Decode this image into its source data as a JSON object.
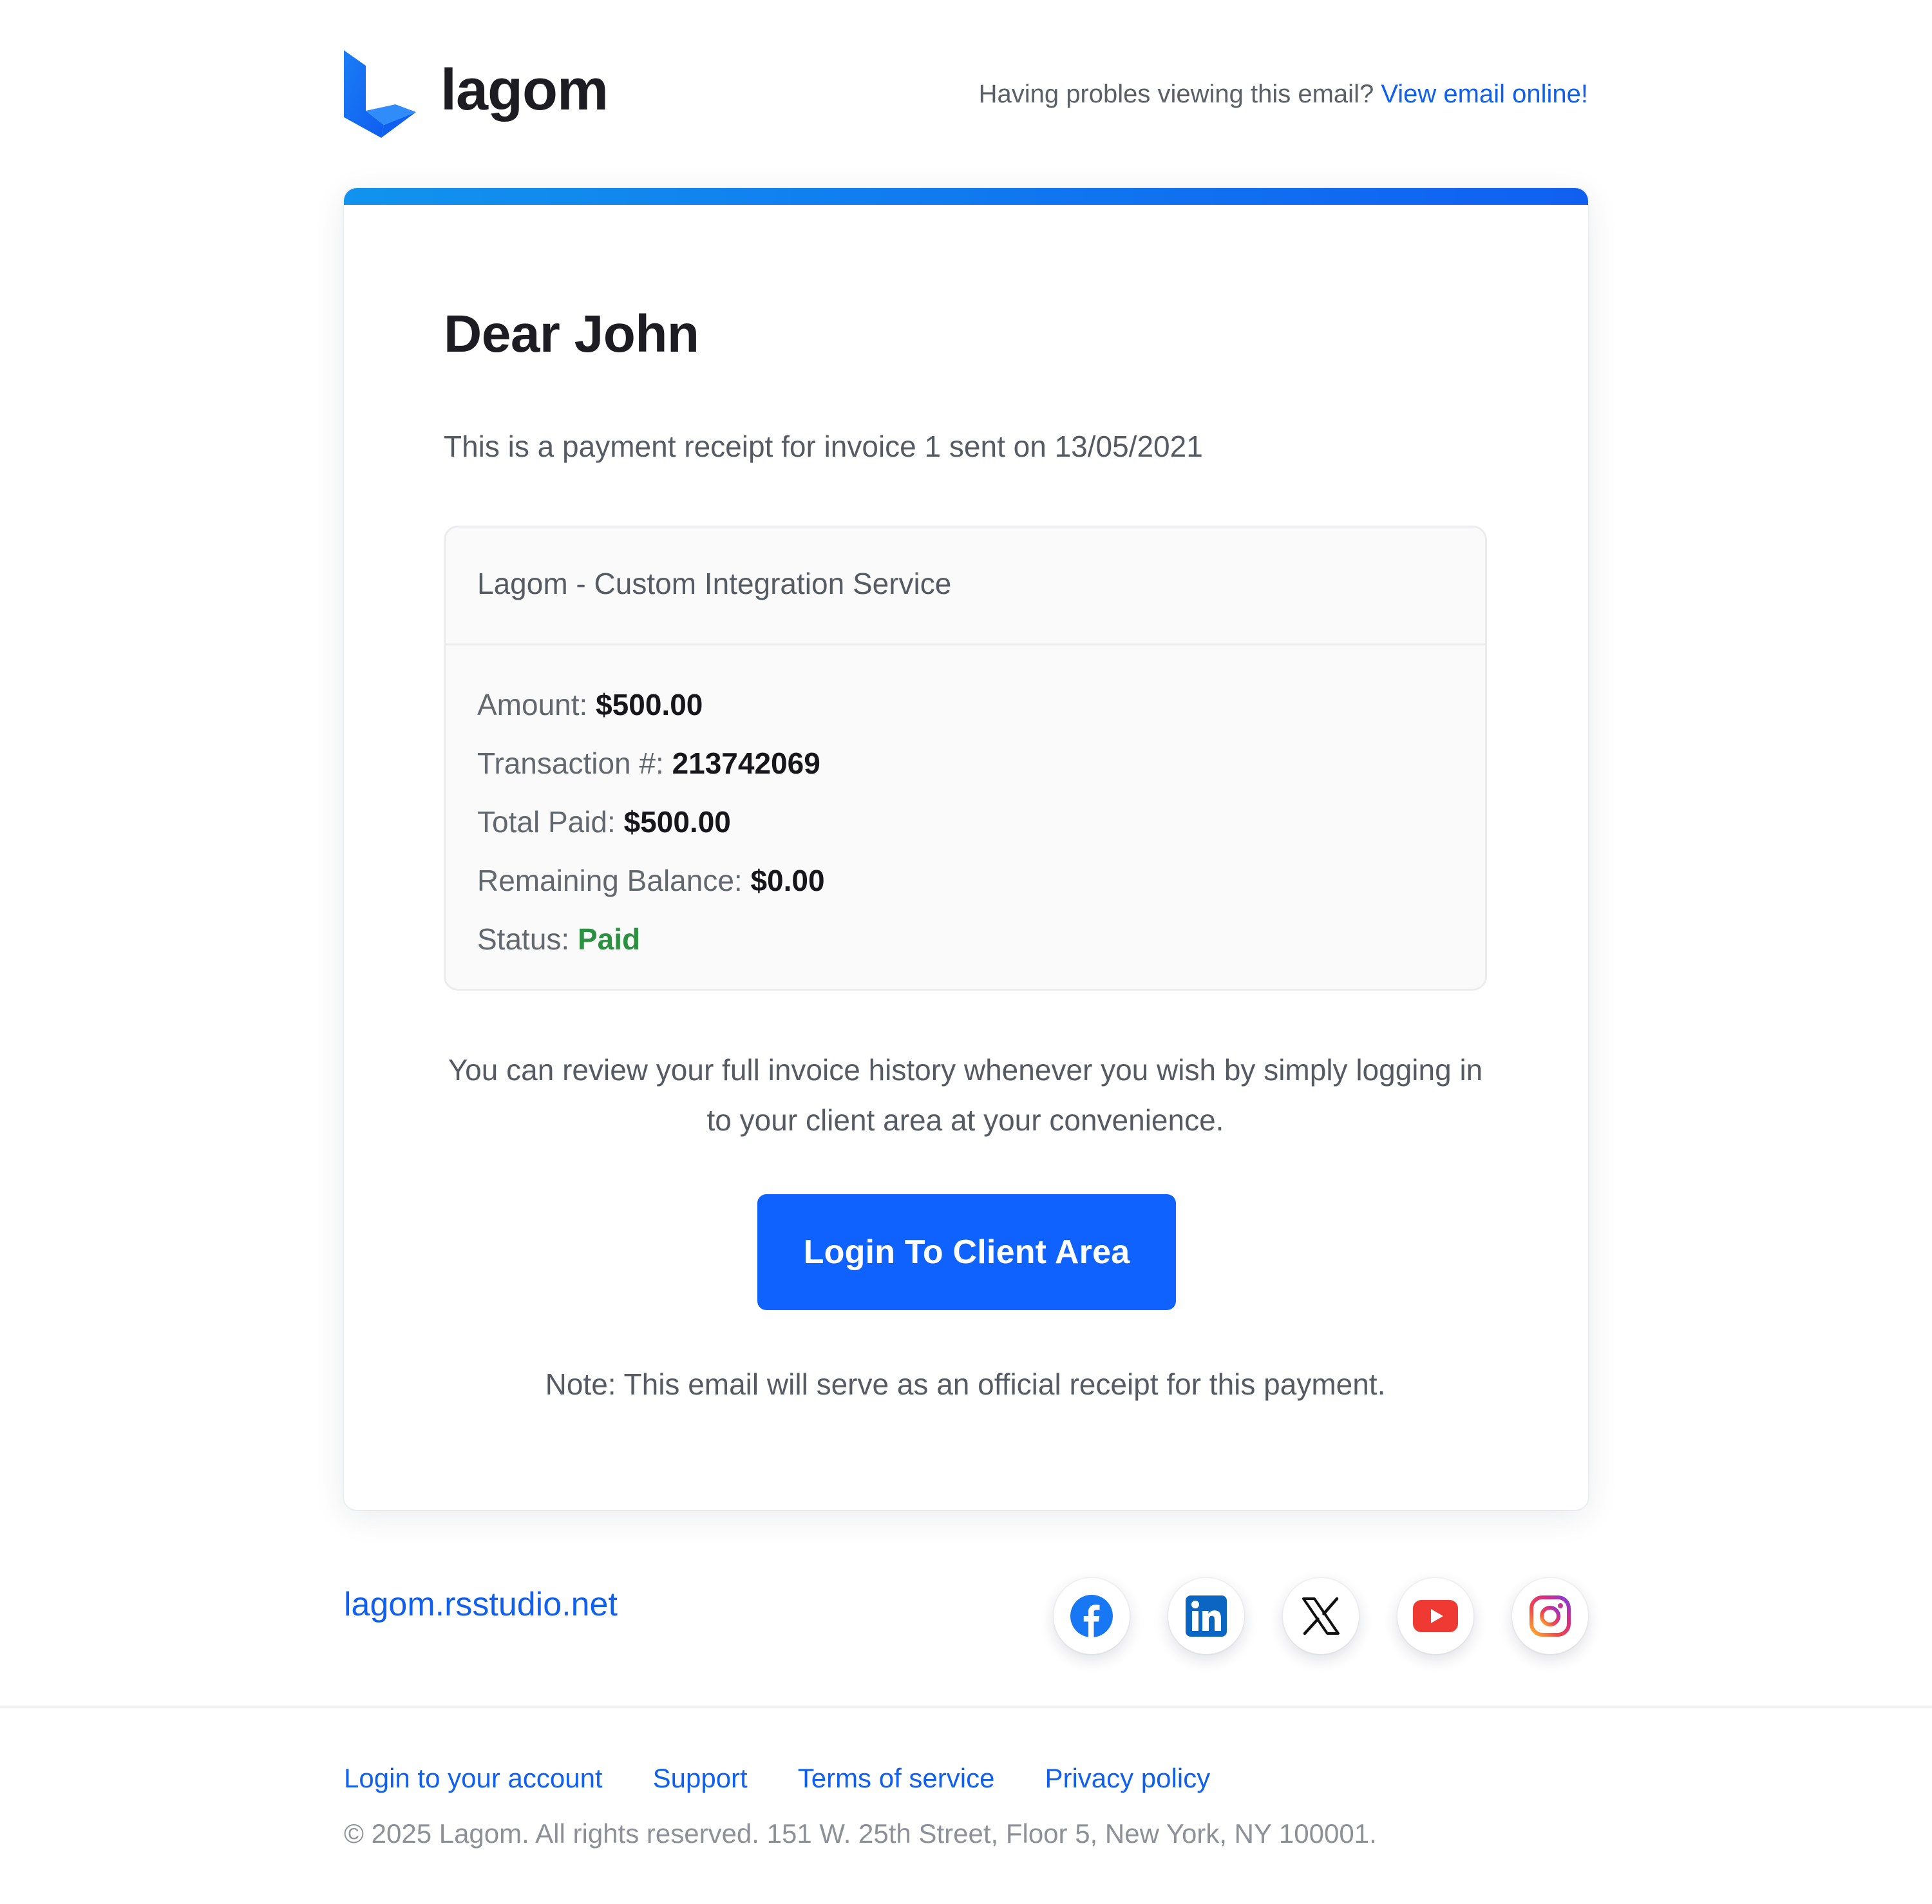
{
  "header": {
    "brand_name": "lagom",
    "note_text": "Having probles viewing this email?",
    "view_online_link": "View email online!"
  },
  "email": {
    "greeting": "Dear John",
    "intro": "This is a payment receipt for invoice 1 sent on 13/05/2021",
    "service_title": "Lagom - Custom Integration Service",
    "details": {
      "amount_label": "Amount:",
      "amount_value": "$500.00",
      "transaction_label": "Transaction #:",
      "transaction_value": "213742069",
      "total_paid_label": "Total Paid:",
      "total_paid_value": "$500.00",
      "remaining_label": "Remaining Balance:",
      "remaining_value": "$0.00",
      "status_label": "Status:",
      "status_value": "Paid"
    },
    "review_text": "You can review your full invoice history whenever you wish by simply logging in to your client area at your convenience.",
    "cta_label": "Login To Client Area",
    "note": "Note: This email will serve as an official receipt for this payment."
  },
  "footer": {
    "site_link": "lagom.rsstudio.net",
    "socials": [
      "facebook-icon",
      "linkedin-icon",
      "x-icon",
      "youtube-icon",
      "instagram-icon"
    ],
    "links": {
      "login": "Login to your account",
      "support": "Support",
      "terms": "Terms of service",
      "privacy": "Privacy policy"
    },
    "copyright": "© 2025 Lagom. All rights reserved. 151 W. 25th Street, Floor 5, New York, NY 100001."
  },
  "colors": {
    "accent": "#0f62fe",
    "link": "#1060f0",
    "paid": "#2a9140",
    "gradient_start": "#1193ee",
    "gradient_end": "#1060f0"
  }
}
